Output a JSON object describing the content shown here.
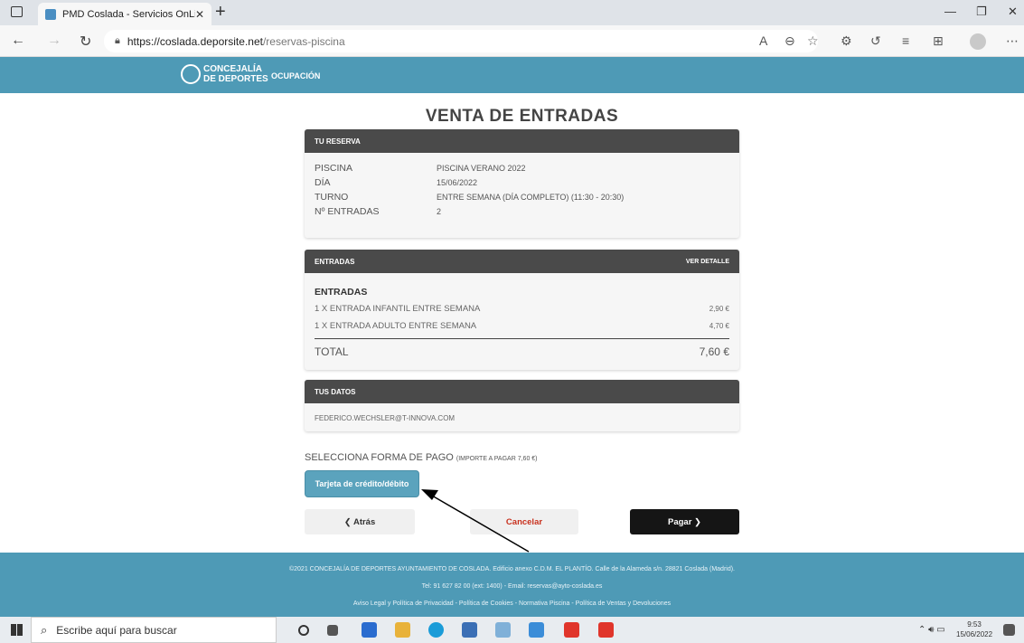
{
  "browser": {
    "tab_title": "PMD Coslada - Servicios OnLine",
    "tab_close": "✕",
    "new_tab": "+",
    "url_domain": "https://coslada.deporsite.net",
    "url_path": "/reservas-piscina"
  },
  "header": {
    "logo_line1": "CONCEJALÍA",
    "logo_line2": "DE DEPORTES",
    "nav_ocupacion": "OCUPACIÓN"
  },
  "page_title": "VENTA DE ENTRADAS",
  "reserva": {
    "heading": "TU RESERVA",
    "rows": [
      {
        "label": "PISCINA",
        "value": "PISCINA VERANO 2022"
      },
      {
        "label": "DÍA",
        "value": "15/06/2022"
      },
      {
        "label": "TURNO",
        "value": "ENTRE SEMANA (DÍA COMPLETO) (11:30 - 20:30)"
      },
      {
        "label": "Nº ENTRADAS",
        "value": "2"
      }
    ]
  },
  "entradas": {
    "heading": "ENTRADAS",
    "detail_link": "VER DETALLE",
    "subtitle": "ENTRADAS",
    "items": [
      {
        "name": "1 X ENTRADA INFANTIL ENTRE SEMANA",
        "price": "2,90 €"
      },
      {
        "name": "1 X ENTRADA ADULTO ENTRE SEMANA",
        "price": "4,70 €"
      }
    ],
    "total_label": "TOTAL",
    "total_value": "7,60 €"
  },
  "datos": {
    "heading": "TUS DATOS",
    "email": "FEDERICO.WECHSLER@T-INNOVA.COM"
  },
  "pago": {
    "label": "SELECCIONA FORMA DE PAGO",
    "importe": "(IMPORTE A PAGAR 7,60 €)",
    "card_button": "Tarjeta de crédito/débito"
  },
  "actions": {
    "back": "❮  Atrás",
    "cancel": "Cancelar",
    "pay": "Pagar  ❯"
  },
  "footer": {
    "line1": "©2021 CONCEJALÍA DE DEPORTES AYUNTAMIENTO DE COSLADA. Edificio anexo C.D.M. EL PLANTÍO. Calle de la Alameda s/n. 28821 Coslada (Madrid).",
    "line2": "Tel: 91 627 82 00 (ext: 1400) - Email: reservas@ayto-coslada.es",
    "line3": "Aviso Legal y Política de Privacidad - Política de Cookies - Normativa Piscina - Política de Ventas y Devoluciones"
  },
  "taskbar": {
    "search_placeholder": "Escribe aquí para buscar",
    "time": "9:53",
    "date": "15/06/2022"
  },
  "colors": {
    "brand": "#4e9ab6",
    "card_header": "#4a4a4a",
    "pay_button": "#151515",
    "cancel_text": "#c8311e"
  }
}
